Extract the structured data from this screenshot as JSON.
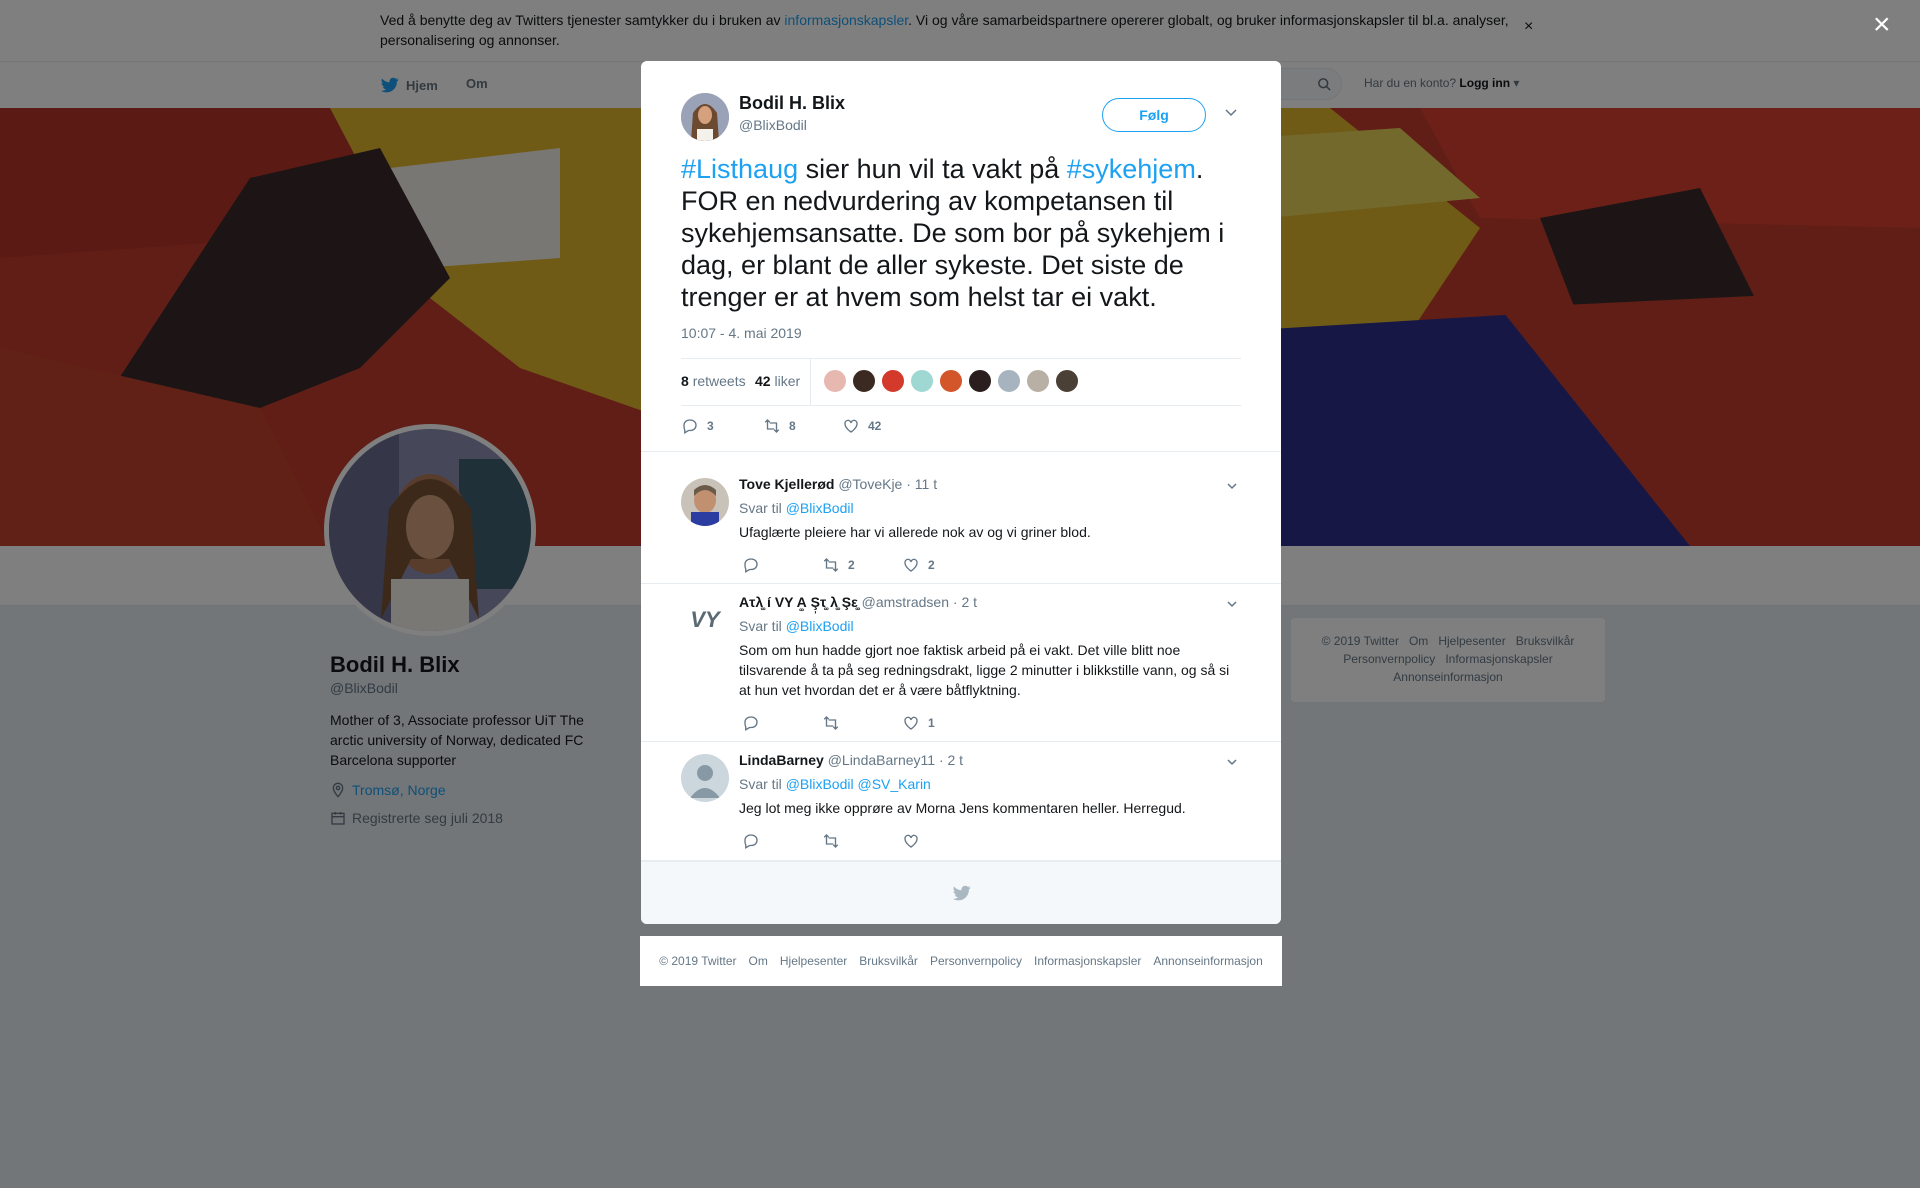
{
  "cookie": {
    "text_before": "Ved å benytte deg av Twitters tjenester samtykker du i bruken av ",
    "link": "informasjonskapsler",
    "text_after": ". Vi og våre samarbeidspartnere opererer globalt, og bruker informasjonskapsler til bl.a. analyser, personalisering og annonser.",
    "close": "×"
  },
  "nav": {
    "home": "Hjem",
    "about": "Om",
    "account_prompt": "Har du en konto?",
    "login": "Logg inn"
  },
  "profile": {
    "name": "Bodil H. Blix",
    "handle": "@BlixBodil",
    "bio": "Mother of 3, Associate professor UiT The arctic university of Norway, dedicated FC Barcelona supporter",
    "location": "Tromsø, Norge",
    "joined": "Registrerte seg juli 2018"
  },
  "side_footer": {
    "line1": [
      "© 2019 Twitter",
      "Om",
      "Hjelpesenter",
      "Bruksvilkår"
    ],
    "line2": [
      "Personvernpolicy",
      "Informasjonskapsler"
    ],
    "line3": [
      "Annonseinformasjon"
    ]
  },
  "overlay_close": "×",
  "tweet": {
    "author_name": "Bodil H. Blix",
    "author_handle": "@BlixBodil",
    "follow_label": "Følg",
    "hashtag1": "#Listhaug",
    "text1": " sier hun vil ta vakt på ",
    "hashtag2": "#sykehjem",
    "text2": ". FOR en nedvurdering av kompetansen til sykehjemsansatte. De som bor på sykehjem i dag, er blant de aller sykeste. Det siste de trenger er at hvem som helst tar ei vakt.",
    "timestamp": "10:07 - 4. mai 2019",
    "retweets_count": "8",
    "retweets_label": "retweets",
    "likes_count": "42",
    "likes_label": "liker",
    "action_reply": "3",
    "action_retweet": "8",
    "action_like": "42",
    "liker_colors": [
      "#e7b8b0",
      "#3b2a22",
      "#d43a2c",
      "#9fd8d3",
      "#d2562a",
      "#2a1f1e",
      "#a7b4bf",
      "#b8b0a5",
      "#4a4036"
    ]
  },
  "replies": [
    {
      "name": "Tove Kjellerød",
      "handle": "@ToveKje",
      "time": "· 11 t",
      "reply_to_label": "Svar til",
      "reply_to": "@BlixBodil",
      "text": "Ufaglærte pleiere har vi allerede nok av og vi griner blod.",
      "replies": "",
      "retweets": "2",
      "likes": "2"
    },
    {
      "name": "Aτλ͚ í VY A͚ Ş̩τ͚ λ͚ Şε͚",
      "handle": "@amstradsen",
      "time": "· 2 t",
      "reply_to_label": "Svar til",
      "reply_to": "@BlixBodil",
      "text": "Som om hun hadde gjort noe faktisk arbeid på ei vakt. Det ville blitt noe tilsvarende å ta på seg redningsdrakt, ligge 2 minutter i blikkstille vann, og så si at hun vet hvordan det er å være båtflyktning.",
      "avatar_text": "VY",
      "replies": "",
      "retweets": "",
      "likes": "1"
    },
    {
      "name": "LindaBarney",
      "handle": "@LindaBarney11",
      "time": "· 2 t",
      "reply_to_label": "Svar til",
      "reply_to": "@BlixBodil @SV_Karin",
      "text": "Jeg lot meg ikke opprøre av Morna Jens kommentaren heller. Herregud.",
      "replies": "",
      "retweets": "",
      "likes": ""
    }
  ],
  "footer": {
    "items": [
      "© 2019 Twitter",
      "Om",
      "Hjelpesenter",
      "Bruksvilkår",
      "Personvernpolicy",
      "Informasjonskapsler",
      "Annonseinformasjon"
    ]
  },
  "colors": {
    "accent": "#1da1f2",
    "overlay": "rgba(0,0,0,0.5)"
  }
}
